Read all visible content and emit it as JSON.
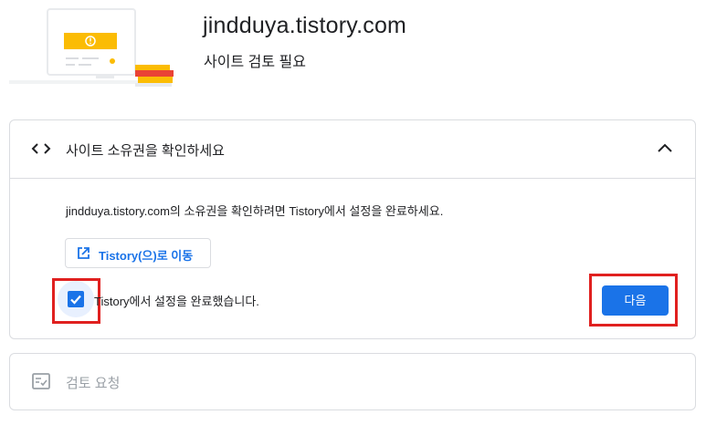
{
  "header": {
    "site_title": "jindduya.tistory.com",
    "subtitle": "사이트 검토 필요"
  },
  "verify_section": {
    "icon": "code-icon",
    "title": "사이트 소유권을 확인하세요",
    "expanded": true,
    "description": "jindduya.tistory.com의 소유권을 확인하려면 Tistory에서 설정을 완료하세요.",
    "link_button_label": "Tistory(으)로 이동",
    "checkbox_label": "Tistory에서 설정을 완료했습니다.",
    "checkbox_checked": true,
    "next_button_label": "다음"
  },
  "review_section": {
    "icon": "review-icon",
    "title": "검토 요청"
  },
  "colors": {
    "accent": "#1a73e8",
    "annotation": "#e0201f",
    "border": "#dadce0",
    "disabled_text": "#9aa0a6"
  }
}
